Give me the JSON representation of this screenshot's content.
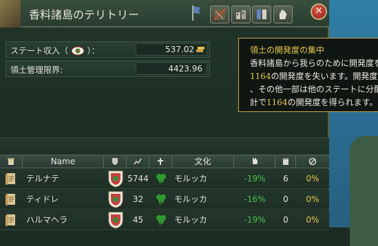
{
  "window": {
    "title": "香料諸島のテリトリー",
    "close_label": "✕",
    "toolbar_buttons": [
      "territory-icon",
      "buildings-icon",
      "edicts-icon",
      "hand-icon"
    ]
  },
  "state": {
    "income_label": "ステート収入（",
    "income_label_end": "）：",
    "income_value": "537.02",
    "governing_label": "領土管理限界:",
    "governing_value": "4423.96"
  },
  "tooltip": {
    "title": "領土の開発度の集中",
    "line1": "香料諸島から我らのために開発度を",
    "line2_num": "1164",
    "line2_text": "の開発度を失います。開発度",
    "line3": "、その他一部は他のステートに分配",
    "line4_pre": "計で",
    "line4_num": "1164",
    "line4_post": "の開発度を得られます。"
  },
  "table": {
    "headers": {
      "name": "Name",
      "culture": "文化"
    },
    "rows": [
      {
        "name": "テルナテ",
        "dev": "5744",
        "culture": "モルッカ",
        "pct": "-19%",
        "count": "6",
        "ratio": "0%"
      },
      {
        "name": "ティドレ",
        "dev": "32",
        "culture": "モルッカ",
        "pct": "-16%",
        "count": "0",
        "ratio": "0%"
      },
      {
        "name": "ハルマヘラ",
        "dev": "45",
        "culture": "モルッカ",
        "pct": "-19%",
        "count": "0",
        "ratio": "0%"
      }
    ]
  },
  "colors": {
    "positive": "#4cc24c",
    "highlight": "#e8c84a",
    "frame": "#c9a94a"
  }
}
